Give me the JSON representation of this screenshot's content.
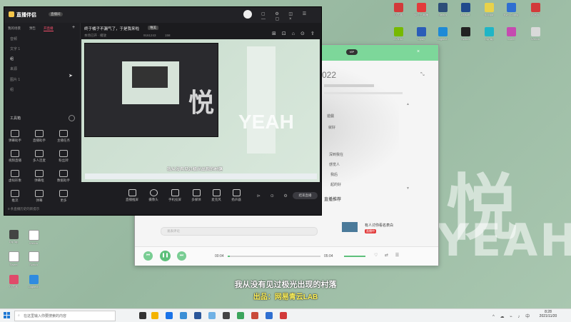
{
  "desktop": {
    "watermark_top": "悦",
    "watermark_mid": "YEAH",
    "subtitle_line1": "我从没有见过极光出现的村落",
    "subtitle_line2": "出品：网易青云LAB",
    "icons_right": [
      {
        "label": "小黑盒",
        "color": "#d23a3a"
      },
      {
        "label": "卡片工具箱",
        "color": "#e23b3b"
      },
      {
        "label": "Steam",
        "color": "#2d4e78"
      },
      {
        "label": "Ubisoft",
        "color": "#204a8c"
      },
      {
        "label": "Koolpa",
        "color": "#e8d24a"
      },
      {
        "label": "Kvm Config",
        "color": "#2f6fd1"
      },
      {
        "label": "网易云",
        "color": "#d23a3a"
      },
      {
        "label": "NVIDIA",
        "color": "#76b900"
      },
      {
        "label": "Uplay",
        "color": "#2b5db8"
      },
      {
        "label": "Logitech",
        "color": "#1e8ad6"
      },
      {
        "label": "Switch",
        "color": "#222"
      },
      {
        "label": "TapTap",
        "color": "#1fb5c6"
      },
      {
        "label": "Sweet",
        "color": "#c54bb0"
      },
      {
        "label": "Weixin",
        "color": "#d9d9d9"
      }
    ]
  },
  "player": {
    "year": "022",
    "lyric1": "遊戲",
    "lyric2": "就好",
    "lyric3": "深到我在",
    "lyric4": "感觉人",
    "lyric5": "我后",
    "lyric6": "起的好",
    "comment_placeholder": "发表评论",
    "recommend_title": "直播推荐",
    "recommend_item": "有人讨你看名表白",
    "recommend_tag": "直播中",
    "time_current": "00:04",
    "time_total": "05:04"
  },
  "stream": {
    "logo": "直播伴侣",
    "tab_badge": "直播间",
    "tab1": "我的场景",
    "tab2": "预告",
    "tab3": "开直播",
    "title": "终于橘子不漏气了，于是我来啦",
    "tag": "唯美",
    "sub_info": "本场已开 · 播放",
    "room": "9161243",
    "viewers": "158",
    "layers": [
      "音频",
      "文字 1",
      "组",
      "来源",
      "图片 1",
      "组"
    ],
    "toolbox_title": "工具箱",
    "tools": [
      "弹幕助手",
      "直播助手",
      "主播任务",
      "视频直播",
      "多人连麦",
      "粉丝牌",
      "虚拟形象",
      "弹幕框",
      "数据助手",
      "推流",
      "弹幕",
      "更多"
    ],
    "ctrl": [
      "直播推屏",
      "摄像头",
      "手机投屏",
      "多媒体",
      "麦克风",
      "扬声器"
    ],
    "live_btn": "结束直播",
    "footer": "0 条直播历史的新提示"
  },
  "taskbar": {
    "search_placeholder": "在这里输入你要搜索的内容",
    "time": "8:28",
    "date": "2021/11/20"
  }
}
